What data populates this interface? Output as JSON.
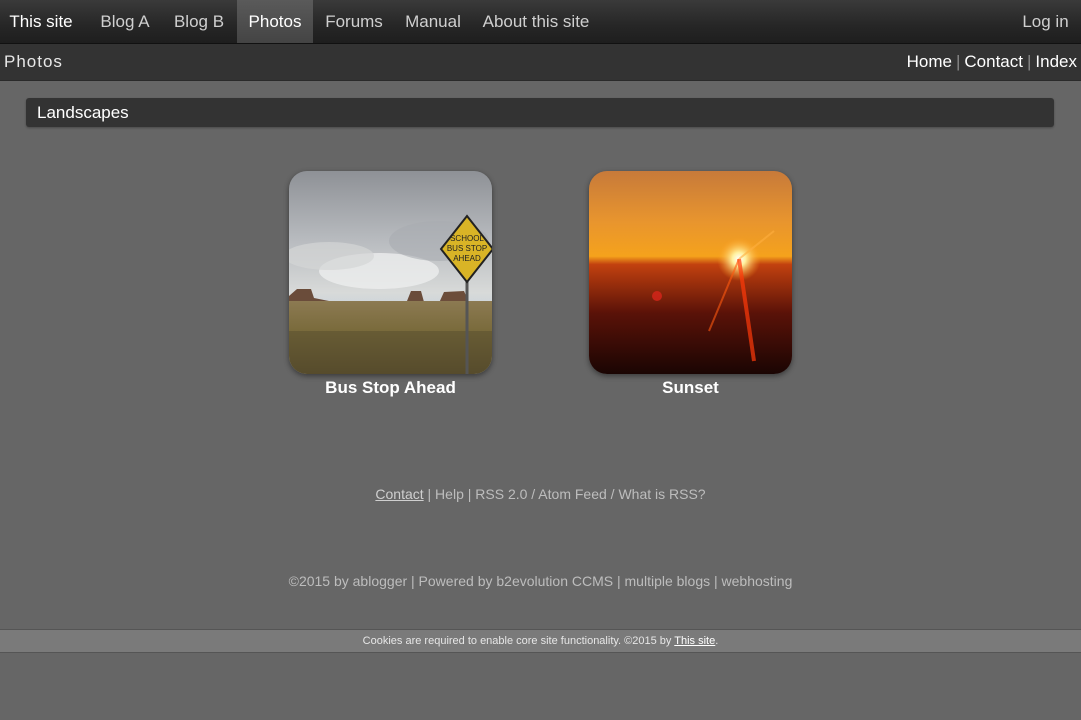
{
  "topnav": {
    "site": "This site",
    "items": [
      {
        "label": "Blog A"
      },
      {
        "label": "Blog B"
      },
      {
        "label": "Photos"
      },
      {
        "label": "Forums"
      },
      {
        "label": "Manual"
      },
      {
        "label": "About this site"
      }
    ],
    "login": "Log in"
  },
  "subbar": {
    "title": "Photos",
    "links": [
      "Home",
      "Contact",
      "Index"
    ]
  },
  "section": {
    "title": "Landscapes"
  },
  "photos": [
    {
      "caption": "Bus Stop Ahead",
      "sign_text": [
        "SCHOOL",
        "BUS STOP",
        "AHEAD"
      ]
    },
    {
      "caption": "Sunset"
    }
  ],
  "footer": {
    "contact": "Contact",
    "rest": " | Help | RSS 2.0 / Atom Feed / What is RSS?",
    "credits": "©2015 by ablogger | Powered by b2evolution CCMS | multiple blogs | webhosting"
  },
  "cookie": {
    "text": "Cookies are required to enable core site functionality. ©2015 by ",
    "link": "This site",
    "end": "."
  },
  "colors": {
    "background": "#666666",
    "bar": "#333333"
  }
}
